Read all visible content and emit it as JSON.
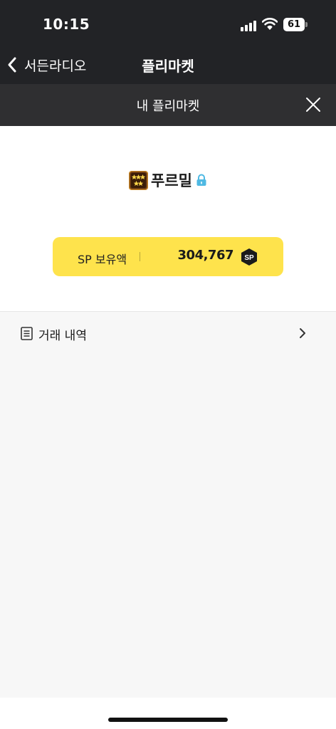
{
  "status_bar": {
    "time": "10:15",
    "battery_level": "61",
    "icons": [
      "cellular-signal-icon",
      "wifi-icon",
      "battery-icon"
    ]
  },
  "nav": {
    "back_label": "서든라디오",
    "title": "플리마켓",
    "back_icon": "chevron-left-icon"
  },
  "sub_header": {
    "title": "내 플리마켓",
    "close_icon": "close-icon"
  },
  "profile": {
    "name": "푸르밀",
    "grade_icon": "grade-badge-icon",
    "lock_icon": "lock-icon"
  },
  "sp_card": {
    "label": "SP 보유액",
    "value": "304,767",
    "badge_text": "SP",
    "color": "#fee34c"
  },
  "history": {
    "label": "거래 내역",
    "icon": "document-list-icon",
    "chevron_icon": "chevron-right-icon"
  },
  "colors": {
    "header_bg": "#222326",
    "sub_header_bg": "#2f2f31",
    "accent": "#fee34c",
    "lock": "#4fb9e3"
  }
}
